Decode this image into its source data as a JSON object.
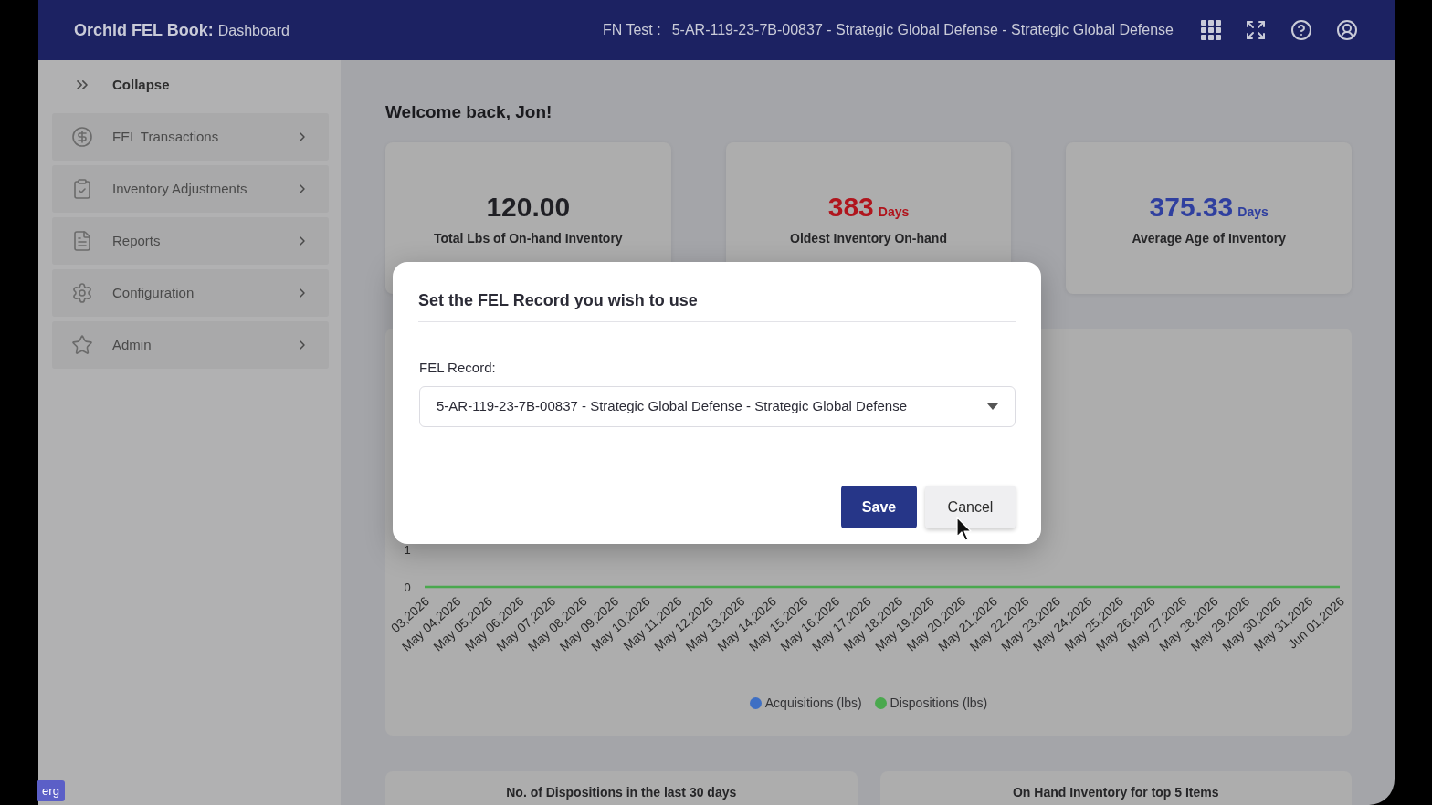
{
  "header": {
    "app_name": "Orchid FEL Book:",
    "page": "Dashboard",
    "record_label": "FN Test :",
    "record": "5-AR-119-23-7B-00837 - Strategic Global Defense - Strategic Global Defense"
  },
  "sidebar": {
    "collapse_label": "Collapse",
    "items": [
      {
        "label": "FEL Transactions"
      },
      {
        "label": "Inventory Adjustments"
      },
      {
        "label": "Reports"
      },
      {
        "label": "Configuration"
      },
      {
        "label": "Admin"
      }
    ]
  },
  "welcome": "Welcome back, Jon!",
  "stats": [
    {
      "value": "120.00",
      "label": "Total Lbs of On-hand Inventory",
      "color": "#1f1f24"
    },
    {
      "value": "383",
      "unit": "Days",
      "label": "Oldest Inventory On-hand",
      "color": "#b0151d"
    },
    {
      "value": "375.33",
      "unit": "Days",
      "label": "Average Age of Inventory",
      "color": "#2f3f9f"
    }
  ],
  "chart": {
    "chart_data": {
      "type": "line",
      "categories": [
        "03,2026",
        "May 04,2026",
        "May 05,2026",
        "May 06,2026",
        "May 07,2026",
        "May 08,2026",
        "May 09,2026",
        "May 10,2026",
        "May 11,2026",
        "May 12,2026",
        "May 13,2026",
        "May 14,2026",
        "May 15,2026",
        "May 16,2026",
        "May 17,2026",
        "May 18,2026",
        "May 19,2026",
        "May 20,2026",
        "May 21,2026",
        "May 22,2026",
        "May 23,2026",
        "May 24,2026",
        "May 25,2026",
        "May 26,2026",
        "May 27,2026",
        "May 28,2026",
        "May 29,2026",
        "May 30,2026",
        "May 31,2026",
        "Jun 01,2026"
      ],
      "series": [
        {
          "name": "Acquisitions (lbs)",
          "color": "#3e6fc4",
          "values": [
            null,
            null,
            null,
            null,
            null,
            null,
            null,
            null,
            null,
            null,
            null,
            null,
            null,
            null,
            null,
            null,
            null,
            null,
            null,
            null,
            null,
            null,
            null,
            null,
            null,
            null,
            null,
            null,
            null,
            null
          ]
        },
        {
          "name": "Dispositions (lbs)",
          "color": "#4aa84e",
          "values": [
            0,
            0,
            0,
            0,
            0,
            0,
            0,
            0,
            0,
            0,
            0,
            0,
            0,
            0,
            0,
            0,
            0,
            0,
            0,
            0,
            0,
            0,
            0,
            0,
            0,
            0,
            0,
            0,
            0,
            0
          ]
        }
      ],
      "ylim": [
        0,
        1
      ],
      "yticks": [
        0,
        1
      ],
      "legend": "bottom"
    }
  },
  "bottom_cards": [
    {
      "title": "No. of Dispositions in the last 30 days"
    },
    {
      "title": "On Hand Inventory for top 5 Items"
    }
  ],
  "dialog": {
    "title": "Set the FEL Record you wish to use",
    "field_label": "FEL Record:",
    "field_value": "5-AR-119-23-7B-00837 - Strategic Global Defense - Strategic Global Defense",
    "buttons": [
      {
        "label": "Save",
        "kind": "primary"
      },
      {
        "label": "Cancel",
        "kind": "secondary"
      }
    ]
  },
  "taskbar": {
    "label": "erg"
  }
}
